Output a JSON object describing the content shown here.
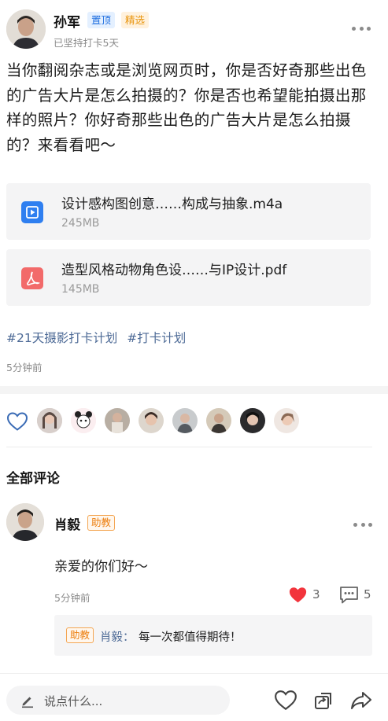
{
  "post": {
    "author": "孙军",
    "badge_pinned": "置顶",
    "badge_featured": "精选",
    "streak": "已坚持打卡5天",
    "body": "当你翻阅杂志或是浏览网页时，你是否好奇那些出色的广告大片是怎么拍摄的？你是否也希望能拍摄出那样的照片？你好奇那些出色的广告大片是怎么拍摄的？来看看吧～",
    "attachments": [
      {
        "name": "设计感构图创意……构成与抽象.m4a",
        "size": "245MB",
        "icon": "media-play-icon",
        "color": "#2f7ff0"
      },
      {
        "name": "造型风格动物角色设……与IP设计.pdf",
        "size": "145MB",
        "icon": "pdf-icon",
        "color": "#f26a6a"
      }
    ],
    "tags": [
      "#21天摄影打卡计划",
      "#打卡计划"
    ],
    "time": "5分钟前"
  },
  "likes": {
    "icon": "heart-outline-icon",
    "avatars": 8
  },
  "comments_section": {
    "title": "全部评论",
    "items": [
      {
        "author": "肖毅",
        "badge": "助教",
        "text": "亲爱的你们好～",
        "time": "5分钟前",
        "like_count": "3",
        "reply_count": "5",
        "reply": {
          "badge": "助教",
          "author": "肖毅：",
          "text": "每一次都值得期待！"
        }
      }
    ]
  },
  "bottom_bar": {
    "input_placeholder": "说点什么...",
    "icons": [
      "like-icon",
      "share-card-icon",
      "forward-icon"
    ]
  },
  "colors": {
    "accent_blue": "#1f6fe0",
    "tag_link": "#4d6a96",
    "badge_orange": "#ec7e0e",
    "heart_red": "#f2343c"
  }
}
